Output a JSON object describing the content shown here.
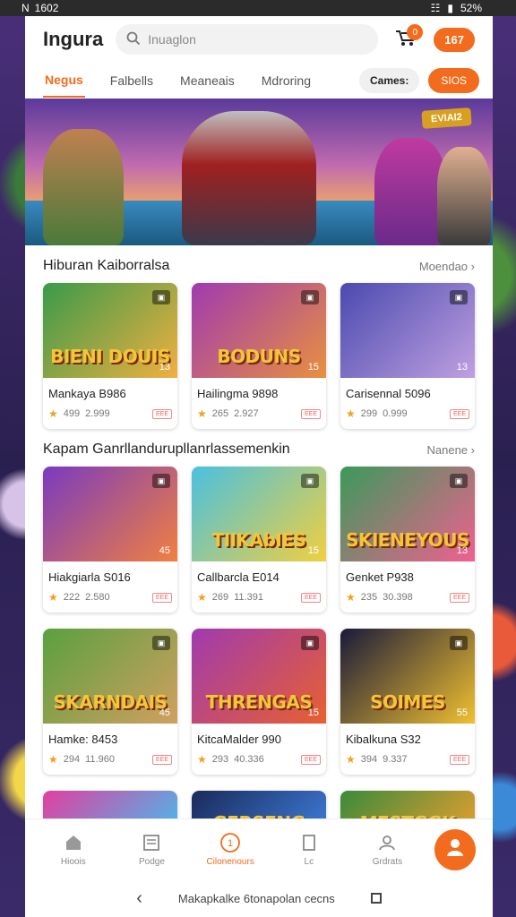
{
  "status_bar": {
    "left": "███",
    "clock": "1602",
    "battery": "52%"
  },
  "header": {
    "app_title": "Ingura",
    "search_placeholder": "Inuaglon",
    "cart_badge": "0",
    "coins": "167"
  },
  "tabs": {
    "items": [
      {
        "label": "Negus",
        "active": true
      },
      {
        "label": "Falbells",
        "active": false
      },
      {
        "label": "Meaneais",
        "active": false
      },
      {
        "label": "Mdroring",
        "active": false
      }
    ],
    "games_label": "Cames:",
    "sios_label": "SIOS"
  },
  "hero": {
    "badge": "EVIAI2"
  },
  "section1": {
    "title": "Hiburan Kaiborralsa",
    "more": "Moendao",
    "cards": [
      {
        "thumb_text": "BIENI DOUIS",
        "corner": "▣",
        "num": "13",
        "name": "Mankaya B986",
        "rating": "499",
        "plays": "2.999",
        "tag": "ЕЕЕ",
        "palette": [
          "#3a9a4a",
          "#f0b040"
        ]
      },
      {
        "thumb_text": "BODUNS",
        "corner": "▣",
        "num": "15",
        "name": "Hailingma 9898",
        "rating": "265",
        "plays": "2.927",
        "tag": "ЕЕЕ",
        "palette": [
          "#a03ab0",
          "#e89040"
        ]
      },
      {
        "thumb_text": "",
        "corner": "▣",
        "num": "13",
        "name": "Carisennal 5096",
        "rating": "299",
        "plays": "0.999",
        "tag": "ЕЕЕ",
        "palette": [
          "#4a4ab0",
          "#c0a0e0"
        ]
      }
    ]
  },
  "section2": {
    "title": "Kapam Ganrllandurupllanrlassemenkin",
    "more": "Nanene",
    "cards": [
      {
        "thumb_text": "",
        "corner": "▣",
        "num": "45",
        "name": "Hiakgiarla S016",
        "rating": "222",
        "plays": "2.580",
        "tag": "ЕЕЕ",
        "palette": [
          "#7a3ac0",
          "#f08040"
        ]
      },
      {
        "thumb_text": "TIIKAbIES",
        "corner": "▣",
        "num": "15",
        "name": "Callbarcla E014",
        "rating": "269",
        "plays": "11.391",
        "tag": "ЕЕЕ",
        "palette": [
          "#4ac0e0",
          "#f0d040"
        ]
      },
      {
        "thumb_text": "SKIENEYOUS",
        "corner": "▣",
        "num": "13",
        "name": "Genket P938",
        "rating": "235",
        "plays": "30.398",
        "tag": "ЕЕЕ",
        "palette": [
          "#3a9a5a",
          "#f06090"
        ]
      }
    ],
    "cards_row2": [
      {
        "thumb_text": "SKARNDAIS",
        "corner": "▣",
        "num": "45",
        "name": "Hamke: 8453",
        "rating": "294",
        "plays": "11.960",
        "tag": "ЕЕЕ",
        "palette": [
          "#5aa040",
          "#d0a060"
        ]
      },
      {
        "thumb_text": "THRENGAS",
        "corner": "▣",
        "num": "15",
        "name": "KitcaMalder 990",
        "rating": "293",
        "plays": "40.336",
        "tag": "ЕЕЕ",
        "palette": [
          "#a03ab0",
          "#e86030"
        ]
      },
      {
        "thumb_text": "SOIMES",
        "corner": "▣",
        "num": "55",
        "name": "Kibalkuna S32",
        "rating": "394",
        "plays": "9.337",
        "tag": "ЕЕЕ",
        "palette": [
          "#1a1a3a",
          "#f0c030"
        ]
      }
    ],
    "partial": [
      {
        "thumb_text": "",
        "palette": [
          "#e040a0",
          "#40c0f0"
        ]
      },
      {
        "thumb_text": "GERSENG",
        "palette": [
          "#1a2a5a",
          "#4080e0"
        ]
      },
      {
        "thumb_text": "MESTGGK",
        "palette": [
          "#3a8a3a",
          "#f0a030"
        ]
      }
    ]
  },
  "bottom_nav": {
    "items": [
      {
        "label": "Hioois",
        "icon": "home-icon"
      },
      {
        "label": "Podge",
        "icon": "news-icon"
      },
      {
        "label": "Cilonenours",
        "icon": "coin-icon",
        "active": true
      },
      {
        "label": "Lc",
        "icon": "bookmark-icon"
      },
      {
        "label": "Grdrats",
        "icon": "user-icon"
      }
    ]
  },
  "system_nav": {
    "label": "Makapkalke 6tonapolan cecns"
  }
}
